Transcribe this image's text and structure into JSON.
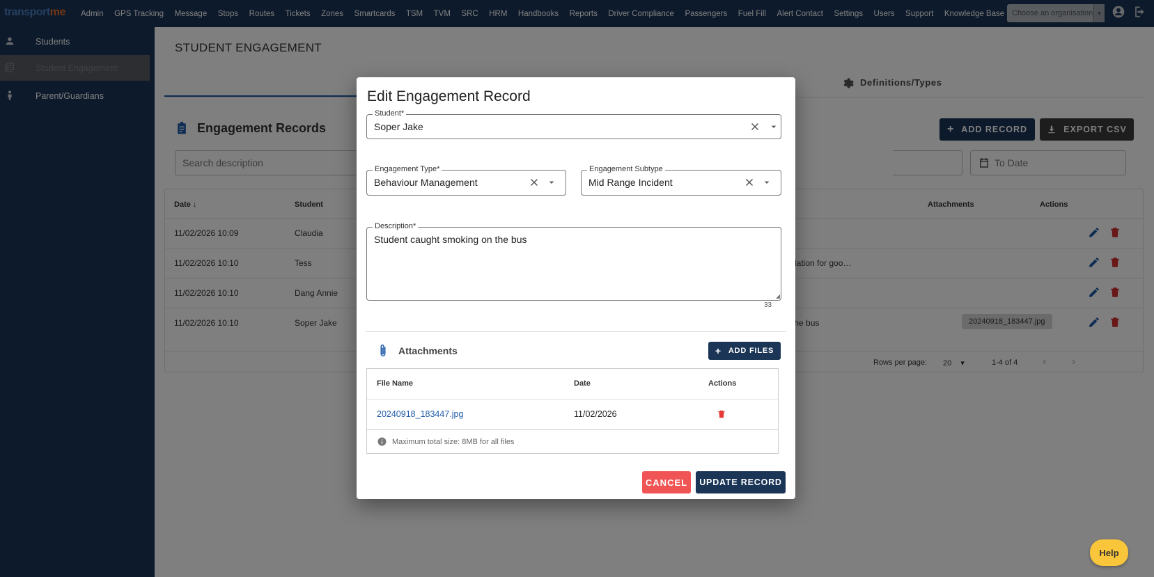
{
  "app": {
    "logo_part1": "transport",
    "logo_part2": "me",
    "org_placeholder": "Choose an organisation"
  },
  "nav": {
    "items": [
      "Admin",
      "GPS Tracking",
      "Message",
      "Stops",
      "Routes",
      "Tickets",
      "Zones",
      "Smartcards",
      "TSM",
      "TVM",
      "SRC",
      "HRM",
      "Handbooks",
      "Reports",
      "Driver Compliance",
      "Passengers",
      "Fuel Fill",
      "Alert Contact",
      "Settings",
      "Users",
      "Support",
      "Knowledge Base"
    ]
  },
  "sidebar": {
    "items": [
      {
        "label": "Students",
        "icon": "person-icon"
      },
      {
        "label": "Student Engagement",
        "icon": "records-icon",
        "active": true
      },
      {
        "label": "Parent/Guardians",
        "icon": "guardian-icon"
      }
    ]
  },
  "page": {
    "title": "STUDENT ENGAGEMENT",
    "tab_definitions": "Definitions/Types",
    "records_title": "Engagement Records",
    "add_record": "ADD RECORD",
    "export_csv": "EXPORT CSV",
    "search_placeholder": "Search description",
    "to_date_placeholder": "To Date"
  },
  "table": {
    "headers": {
      "date": "Date",
      "student": "Student",
      "attachments": "Attachments",
      "actions": "Actions"
    },
    "rows": [
      {
        "date": "11/02/2026 10:09",
        "student": "Claudia",
        "desc": "",
        "attachment": ""
      },
      {
        "date": "11/02/2026 10:10",
        "student": "Tess",
        "desc": "dation for goo…",
        "attachment": ""
      },
      {
        "date": "11/02/2026 10:10",
        "student": "Dang Annie",
        "desc": "",
        "attachment": ""
      },
      {
        "date": "11/02/2026 10:10",
        "student": "Soper Jake",
        "desc": "the bus",
        "attachment": "20240918_183447.jpg"
      }
    ],
    "rows_per_page_label": "Rows per page:",
    "rows_per_page": "20",
    "range": "1-4 of 4"
  },
  "dialog": {
    "title": "Edit Engagement Record",
    "student_label": "Student*",
    "student_value": "Soper Jake",
    "type_label": "Engagement Type*",
    "type_value": "Behaviour Management",
    "subtype_label": "Engagement Subtype",
    "subtype_value": "Mid Range Incident",
    "description_label": "Description*",
    "description_value": "Student caught smoking on the bus",
    "char_count": "33",
    "attachments_title": "Attachments",
    "add_files": "ADD FILES",
    "att_headers": {
      "file_name": "File Name",
      "date": "Date",
      "actions": "Actions"
    },
    "att_file": {
      "name": "20240918_183447.jpg",
      "date": "11/02/2026"
    },
    "max_size_note": "Maximum total size: 8MB for all files",
    "cancel": "CANCEL",
    "update": "UPDATE RECORD"
  },
  "help": "Help",
  "colors": {
    "navy": "#1b3556",
    "accent_blue": "#1f5aa8",
    "danger": "#f05454",
    "delete_red": "#d32f2f",
    "help_yellow": "#f9c53a"
  }
}
